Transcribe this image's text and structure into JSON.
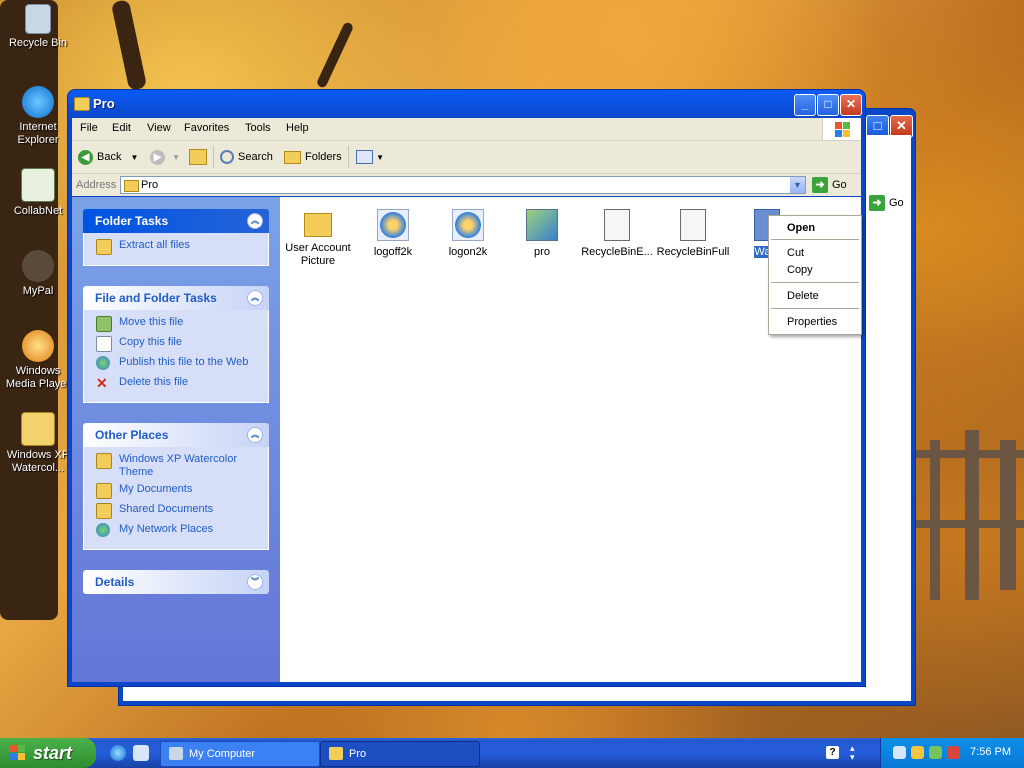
{
  "desktop": {
    "icons": [
      {
        "label": "Recycle Bin",
        "icon": "recycle-bin-icon"
      },
      {
        "label": "Internet Explorer",
        "icon": "internet-explorer-icon"
      },
      {
        "label": "CollabNet",
        "icon": "collabnet-icon"
      },
      {
        "label": "MyPal",
        "icon": "mypal-icon"
      },
      {
        "label": "Windows Media Player",
        "icon": "windows-media-player-icon"
      },
      {
        "label": "Windows XP Watercol...",
        "icon": "zip-folder-icon"
      }
    ]
  },
  "back_window": {
    "go_label": "Go"
  },
  "window": {
    "title": "Pro",
    "menu": [
      "File",
      "Edit",
      "View",
      "Favorites",
      "Tools",
      "Help"
    ],
    "toolbar": {
      "back": "Back",
      "search": "Search",
      "folders": "Folders"
    },
    "address": {
      "label": "Address",
      "value": "Pro",
      "go": "Go"
    },
    "panels": {
      "folder_tasks": {
        "title": "Folder Tasks",
        "items": [
          "Extract all files"
        ]
      },
      "file_folder_tasks": {
        "title": "File and Folder Tasks",
        "items": [
          "Move this file",
          "Copy this file",
          "Publish this file to the Web",
          "Delete this file"
        ]
      },
      "other_places": {
        "title": "Other Places",
        "items": [
          "Windows XP Watercolor Theme",
          "My Documents",
          "Shared Documents",
          "My Network Places"
        ]
      },
      "details": {
        "title": "Details"
      }
    },
    "files": [
      {
        "label": "User Account Picture",
        "icon": "folder-icon"
      },
      {
        "label": "logoff2k",
        "icon": "media-file-icon"
      },
      {
        "label": "logon2k",
        "icon": "media-file-icon"
      },
      {
        "label": "pro",
        "icon": "image-file-icon"
      },
      {
        "label": "RecycleBinE...",
        "icon": "document-file-icon"
      },
      {
        "label": "RecycleBinFull",
        "icon": "document-file-icon"
      },
      {
        "label": "Wate",
        "icon": "document-file-icon",
        "selected": true
      }
    ],
    "context_menu": [
      "Open",
      "Cut",
      "Copy",
      "Delete",
      "Properties"
    ]
  },
  "taskbar": {
    "start": "start",
    "tasks": [
      {
        "label": "My Computer",
        "active": false
      },
      {
        "label": "Pro",
        "active": true
      }
    ],
    "clock": "7:56 PM"
  },
  "colors": {
    "xp_blue": "#0a5bf3",
    "taskbar_blue": "#245ddb",
    "start_green": "#3c9e3c",
    "task_blue": "#215dc6"
  }
}
